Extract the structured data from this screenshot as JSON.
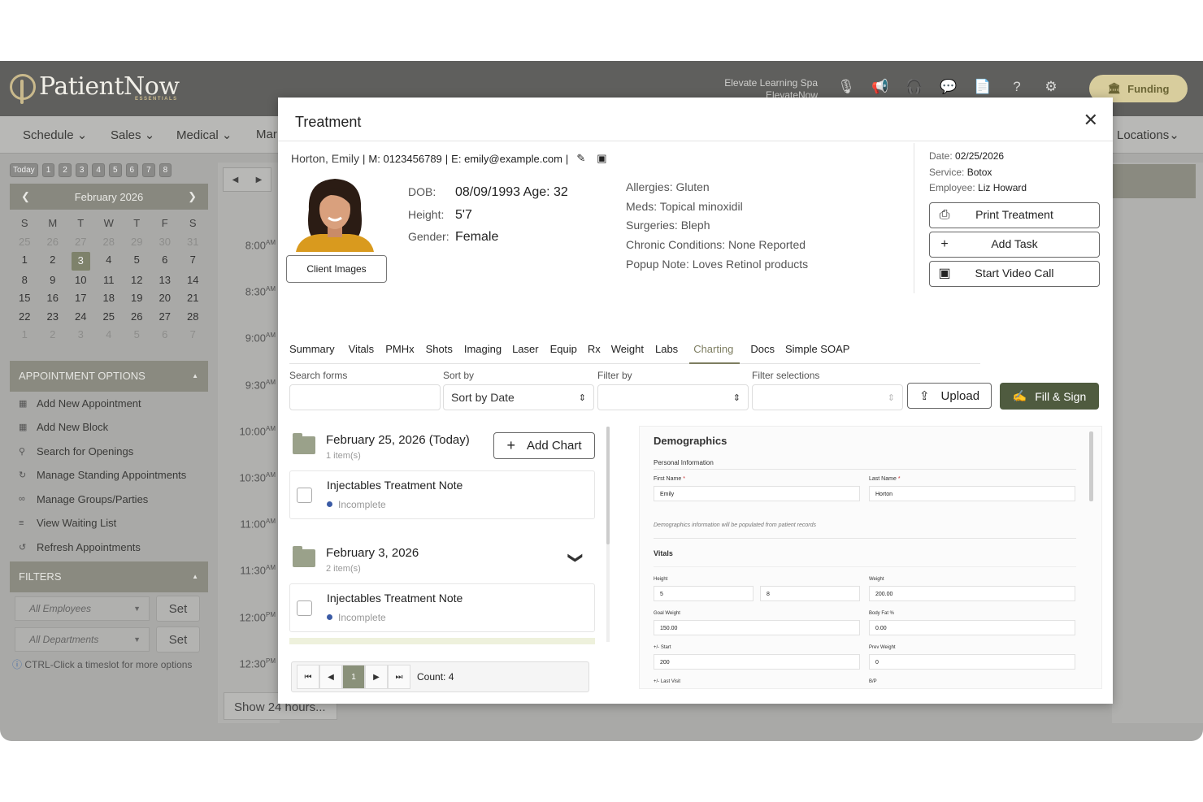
{
  "app": {
    "logo_text": "PatientNow",
    "logo_sub": "ESSENTIALS",
    "org_name": "Elevate Learning Spa",
    "org_sub": "ElevateNow",
    "funding_label": "Funding",
    "icons": [
      "mic-icon",
      "megaphone-icon",
      "headset-icon",
      "chat-icon",
      "document-icon",
      "help-icon",
      "gear-icon"
    ]
  },
  "nav": {
    "items": [
      {
        "label": "Schedule"
      },
      {
        "label": "Sales"
      },
      {
        "label": "Medical"
      },
      {
        "label": "Mar"
      }
    ],
    "locations": "Locations"
  },
  "calendar": {
    "today_label": "Today",
    "day_buttons": [
      "1",
      "2",
      "3",
      "4",
      "5",
      "6",
      "7",
      "8"
    ],
    "month_label": "February 2026",
    "weekday_headers": [
      "S",
      "M",
      "T",
      "W",
      "T",
      "F",
      "S"
    ],
    "weeks": [
      [
        "25",
        "26",
        "27",
        "28",
        "29",
        "30",
        "31"
      ],
      [
        "1",
        "2",
        "3",
        "4",
        "5",
        "6",
        "7"
      ],
      [
        "8",
        "9",
        "10",
        "11",
        "12",
        "13",
        "14"
      ],
      [
        "15",
        "16",
        "17",
        "18",
        "19",
        "20",
        "21"
      ],
      [
        "22",
        "23",
        "24",
        "25",
        "26",
        "27",
        "28"
      ],
      [
        "1",
        "2",
        "3",
        "4",
        "5",
        "6",
        "7"
      ]
    ],
    "selected": "3"
  },
  "appointment_options": {
    "title": "APPOINTMENT OPTIONS",
    "items": [
      "Add New Appointment",
      "Add New Block",
      "Search for Openings",
      "Manage Standing Appointments",
      "Manage Groups/Parties",
      "View Waiting List",
      "Refresh Appointments"
    ]
  },
  "filters": {
    "title": "FILTERS",
    "employees_placeholder": "All Employees",
    "departments_placeholder": "All Departments",
    "set_label": "Set",
    "hint": "CTRL-Click a timeslot for more options"
  },
  "schedule": {
    "times": [
      {
        "t": "8:00",
        "ap": "AM"
      },
      {
        "t": "8:30",
        "ap": "AM"
      },
      {
        "t": "9:00",
        "ap": "AM"
      },
      {
        "t": "9:30",
        "ap": "AM"
      },
      {
        "t": "10:00",
        "ap": "AM"
      },
      {
        "t": "10:30",
        "ap": "AM"
      },
      {
        "t": "11:00",
        "ap": "AM"
      },
      {
        "t": "11:30",
        "ap": "AM"
      },
      {
        "t": "12:00",
        "ap": "PM"
      },
      {
        "t": "12:30",
        "ap": "PM"
      }
    ],
    "show_24": "Show 24 hours..."
  },
  "modal": {
    "title": "Treatment",
    "patient": {
      "name": "Horton, Emily",
      "mobile": "M: 0123456789",
      "email": "E: emily@example.com",
      "dob_label": "DOB:",
      "dob": "08/09/1993 Age: 32",
      "height_label": "Height:",
      "height": "5'7",
      "gender_label": "Gender:",
      "gender": "Female",
      "client_images": "Client Images",
      "allergies": "Allergies: Gluten",
      "meds": "Meds: Topical minoxidil",
      "surgeries": "Surgeries: Bleph",
      "chronic": "Chronic Conditions: None Reported",
      "popup": "Popup Note: Loves Retinol products"
    },
    "visit": {
      "date_label": "Date:",
      "date": "02/25/2026",
      "service_label": "Service:",
      "service": "Botox",
      "employee_label": "Employee:",
      "employee": "Liz Howard"
    },
    "actions": {
      "print": "Print Treatment",
      "task": "Add Task",
      "video": "Start Video Call"
    },
    "tabs": [
      "Summary",
      "Vitals",
      "PMHx",
      "Shots",
      "Imaging",
      "Laser",
      "Equip",
      "Rx",
      "Weight",
      "Labs",
      "Charting",
      "Docs",
      "Simple SOAP"
    ],
    "active_tab": "Charting",
    "filters": {
      "search_label": "Search forms",
      "sort_label": "Sort by",
      "sort_value": "Sort by Date",
      "filter_label": "Filter by",
      "selections_label": "Filter selections",
      "upload": "Upload",
      "fill_sign": "Fill & Sign"
    },
    "groups": [
      {
        "title": "February 25, 2026 (Today)",
        "count": "1 item(s)",
        "add_chart": "Add Chart",
        "note": {
          "title": "Injectables Treatment Note",
          "status": "Incomplete"
        }
      },
      {
        "title": "February 3, 2026",
        "count": "2 item(s)",
        "note": {
          "title": "Injectables Treatment Note",
          "status": "Incomplete"
        }
      }
    ],
    "pager": {
      "page": "1",
      "count": "Count: 4"
    },
    "preview": {
      "heading": "Demographics",
      "personal": "Personal Information",
      "first_name_label": "First Name",
      "first_name": "Emily",
      "last_name_label": "Last Name",
      "last_name": "Horton",
      "required_mark": "*",
      "note": "Demographics information will be populated from patient records",
      "vitals": "Vitals",
      "height_label": "Height",
      "height_ft": "5",
      "height_in": "8",
      "weight_label": "Weight",
      "weight": "200.00",
      "goal_label": "Goal Weight",
      "goal": "150.00",
      "bodyfat_label": "Body Fat %",
      "bodyfat": "0.00",
      "start_label": "+/- Start",
      "start": "200",
      "prev_label": "Prev Weight",
      "prev": "0",
      "last_visit_label": "+/- Last Visit",
      "bp_label": "B/P"
    }
  }
}
